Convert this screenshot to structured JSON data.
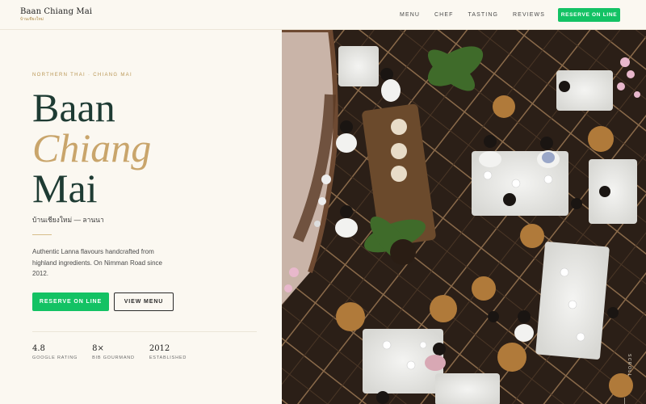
{
  "brand": {
    "name": "Baan Chiang Mai",
    "thai": "บ้านเชียงใหม่"
  },
  "nav": {
    "items": [
      "MENU",
      "CHEF",
      "TASTING",
      "REVIEWS"
    ],
    "cta": "RESERVE ON LINE"
  },
  "hero": {
    "eyebrow": "NORTHERN THAI · CHIANG MAI",
    "title_line1": "Baan",
    "title_line2": "Chiang",
    "title_line3": "Mai",
    "subtitle_thai": "บ้านเชียงใหม่ — ลานนา",
    "description": "Authentic Lanna flavours handcrafted from highland ingredients. On Nimman Road since 2012.",
    "primary_button": "RESERVE ON LINE",
    "secondary_button": "VIEW MENU",
    "scroll_label": "SCROLL"
  },
  "stats": [
    {
      "value": "4.8",
      "label": "GOOGLE RATING"
    },
    {
      "value": "8×",
      "label": "BIB GOURMAND"
    },
    {
      "value": "2012",
      "label": "ESTABLISHED"
    }
  ],
  "colors": {
    "background": "#fbf8f1",
    "accent_green": "#13c264",
    "gold": "#c9a56b",
    "title_dark_green": "#1e3b33"
  }
}
